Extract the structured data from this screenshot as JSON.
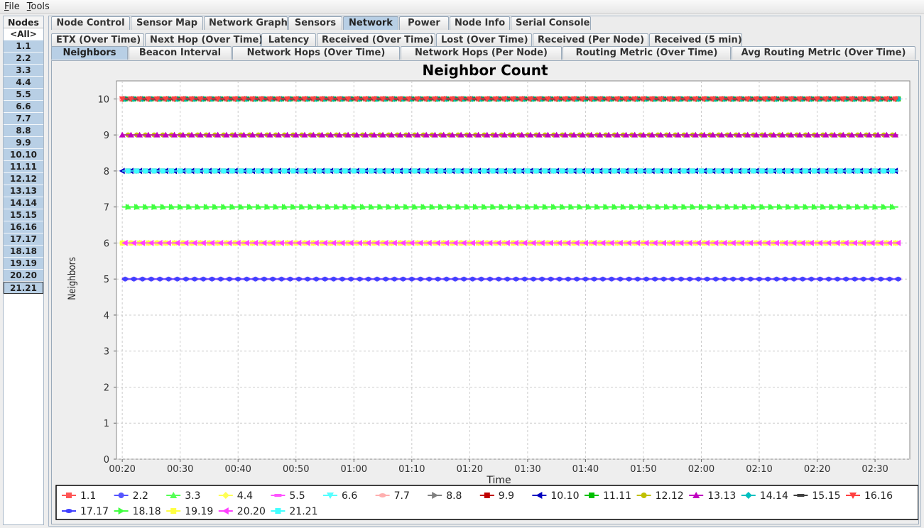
{
  "menubar": {
    "items": [
      {
        "label": "File",
        "u": "F",
        "rest": "ile"
      },
      {
        "label": "Tools",
        "u": "T",
        "rest": "ools"
      }
    ]
  },
  "nodes": {
    "header": "Nodes",
    "all": "<All>",
    "items": [
      "1.1",
      "2.2",
      "3.3",
      "4.4",
      "5.5",
      "6.6",
      "7.7",
      "8.8",
      "9.9",
      "10.10",
      "11.11",
      "12.12",
      "13.13",
      "14.14",
      "15.15",
      "16.16",
      "17.17",
      "18.18",
      "19.19",
      "20.20",
      "21.21"
    ],
    "selected": "21.21"
  },
  "tabs": {
    "main": [
      "Node Control",
      "Sensor Map",
      "Network Graph",
      "Sensors",
      "Network",
      "Power",
      "Node Info",
      "Serial Console"
    ],
    "main_active": "Network",
    "row2": [
      "ETX (Over Time)",
      "Next Hop (Over Time)",
      "Latency",
      "Received (Over Time)",
      "Lost (Over Time)",
      "Received (Per Node)",
      "Received (5 min)"
    ],
    "row3": [
      "Neighbors",
      "Beacon Interval",
      "Network Hops (Over Time)",
      "Network Hops (Per Node)",
      "Routing Metric (Over Time)",
      "Avg Routing Metric (Over Time)"
    ],
    "row3_active": "Neighbors"
  },
  "chart_data": {
    "type": "scatter",
    "title": "Neighbor Count",
    "xlabel": "Time",
    "ylabel": "Neighbors",
    "ylim": [
      0,
      10.5
    ],
    "xlim": [
      "00:19",
      "02:36"
    ],
    "x_ticks": [
      "00:20",
      "00:30",
      "00:40",
      "00:50",
      "01:00",
      "01:10",
      "01:20",
      "01:30",
      "01:40",
      "01:50",
      "02:00",
      "02:10",
      "02:20",
      "02:30"
    ],
    "y_ticks": [
      0,
      1,
      2,
      3,
      4,
      5,
      6,
      7,
      8,
      9,
      10
    ],
    "grid": true,
    "legend_placement": "bottom",
    "series": [
      {
        "name": "1.1",
        "color": "#ff5555",
        "marker": "square",
        "value": 10
      },
      {
        "name": "2.2",
        "color": "#5555ff",
        "marker": "circle",
        "value": 5
      },
      {
        "name": "3.3",
        "color": "#55ff55",
        "marker": "triangle-up",
        "value": 7
      },
      {
        "name": "4.4",
        "color": "#ffff55",
        "marker": "diamond",
        "value": 6
      },
      {
        "name": "5.5",
        "color": "#ff55ff",
        "marker": "rect-h",
        "value": 5
      },
      {
        "name": "6.6",
        "color": "#55ffff",
        "marker": "triangle-down",
        "value": 8
      },
      {
        "name": "7.7",
        "color": "#ffafaf",
        "marker": "ellipse",
        "value": 10
      },
      {
        "name": "8.8",
        "color": "#808080",
        "marker": "triangle-right",
        "value": 10
      },
      {
        "name": "9.9",
        "color": "#c00000",
        "marker": "square",
        "value": 8
      },
      {
        "name": "10.10",
        "color": "#0000c0",
        "marker": "triangle-left",
        "value": 8
      },
      {
        "name": "11.11",
        "color": "#00c000",
        "marker": "square",
        "value": 10
      },
      {
        "name": "12.12",
        "color": "#c0c000",
        "marker": "circle",
        "value": 9
      },
      {
        "name": "13.13",
        "color": "#c000c0",
        "marker": "triangle-up",
        "value": 9
      },
      {
        "name": "14.14",
        "color": "#00c0c0",
        "marker": "diamond",
        "value": 10
      },
      {
        "name": "15.15",
        "color": "#404040",
        "marker": "rect-h",
        "value": 10
      },
      {
        "name": "16.16",
        "color": "#ff4040",
        "marker": "triangle-down",
        "value": 10
      },
      {
        "name": "17.17",
        "color": "#4040ff",
        "marker": "ellipse",
        "value": 5
      },
      {
        "name": "18.18",
        "color": "#40ff40",
        "marker": "triangle-right",
        "value": 7
      },
      {
        "name": "19.19",
        "color": "#ffff40",
        "marker": "square",
        "value": 6
      },
      {
        "name": "20.20",
        "color": "#ff40ff",
        "marker": "triangle-left",
        "value": 6
      },
      {
        "name": "21.21",
        "color": "#40ffff",
        "marker": "square",
        "value": 8
      }
    ]
  }
}
